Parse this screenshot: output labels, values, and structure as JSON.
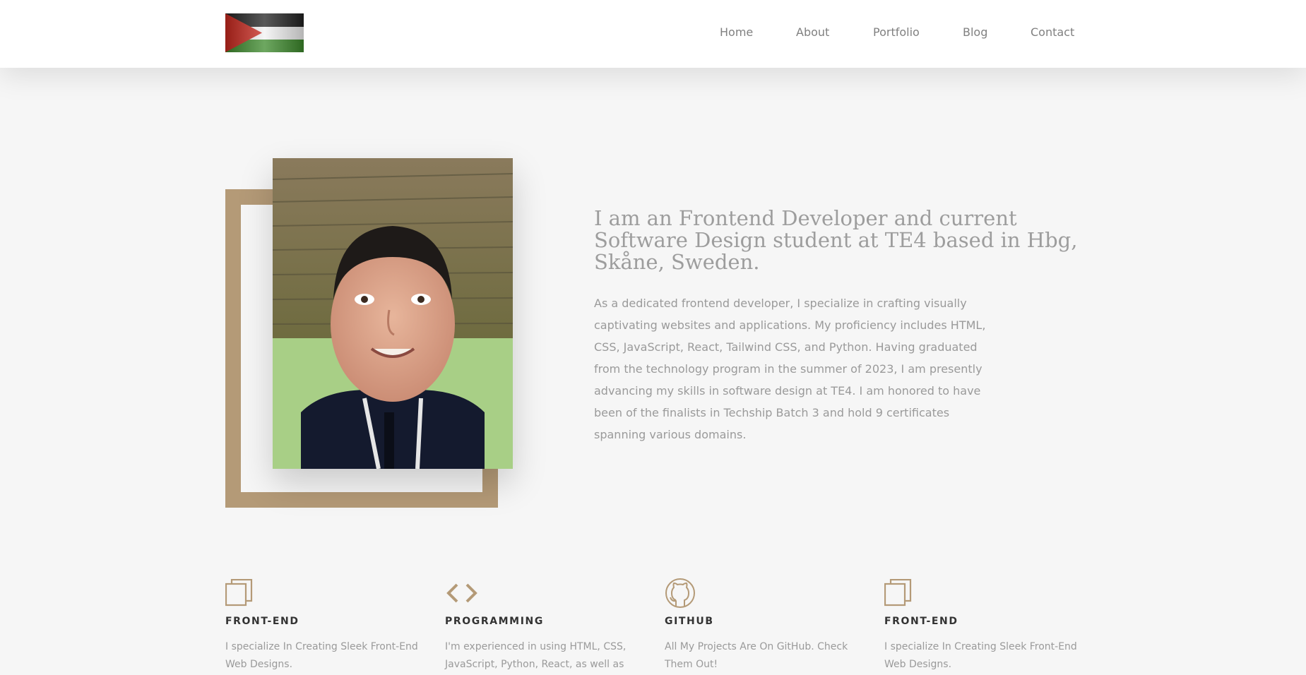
{
  "nav": {
    "logo_alt": "Palestine flag",
    "links": [
      "Home",
      "About",
      "Portfolio",
      "Blog",
      "Contact"
    ]
  },
  "hero": {
    "title": "I am an Frontend Developer and current Software Design student at TE4 based in Hbg, Skåne, Sweden.",
    "text": "As a dedicated frontend developer, I specialize in crafting visually captivating websites and applications. My proficiency includes HTML, CSS, JavaScript, React, Tailwind CSS, and Python. Having graduated from the technology program in the summer of 2023, I am presently advancing my skills in software design at TE4. I am honored to have been of the finalists in Techship Batch 3 and hold 9 certificates spanning various domains."
  },
  "services": [
    {
      "icon": "copy-icon",
      "title": "FRONT-END",
      "desc": "I specialize In Creating Sleek Front-End Web Designs."
    },
    {
      "icon": "code-icon",
      "title": "PROGRAMMING",
      "desc": "I'm experienced in using HTML, CSS, JavaScript, Python, React, as well as"
    },
    {
      "icon": "github-icon",
      "title": "GITHUB",
      "desc": "All My Projects Are On GitHub. Check Them Out!"
    },
    {
      "icon": "copy-icon",
      "title": "FRONT-END",
      "desc": "I specialize In Creating Sleek Front-End Web Designs."
    }
  ],
  "colors": {
    "accent": "#b49a77",
    "background": "#f6f6f6",
    "nav_bg": "#ffffff",
    "text_muted": "#9a9a9a",
    "heading": "#333333"
  }
}
